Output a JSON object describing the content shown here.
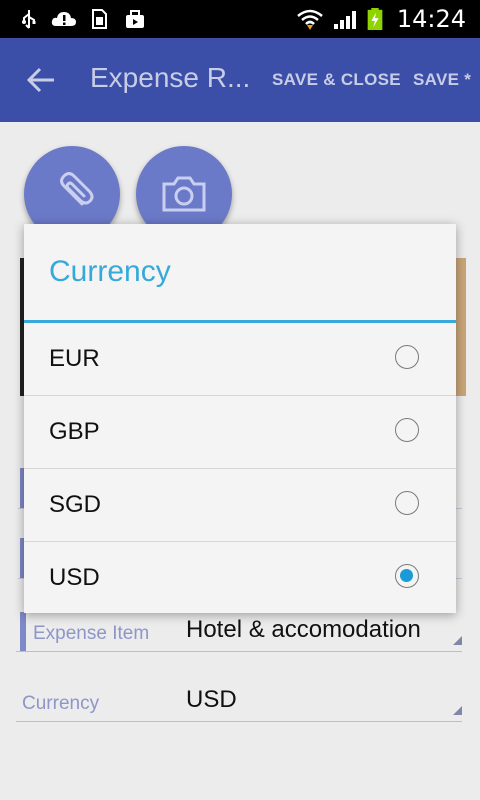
{
  "status_bar": {
    "time": "14:24",
    "icons": [
      "usb-icon",
      "cloud-alert-icon",
      "sim-icon",
      "briefcase-icon",
      "wifi-icon",
      "signal-icon",
      "battery-charging-icon"
    ]
  },
  "action_bar": {
    "title": "Expense R...",
    "save_close_label": "SAVE & CLOSE",
    "save_label": "SAVE *"
  },
  "form": {
    "attach_icon": "paperclip-icon",
    "camera_icon": "camera-icon",
    "expense_item_label": "Expense Item",
    "expense_item_value": "Hotel & accomodation",
    "currency_label": "Currency",
    "currency_value": "USD"
  },
  "dialog": {
    "title": "Currency",
    "options": [
      {
        "label": "EUR",
        "selected": false
      },
      {
        "label": "GBP",
        "selected": false
      },
      {
        "label": "SGD",
        "selected": false
      },
      {
        "label": "USD",
        "selected": true
      }
    ],
    "accent": "#35a9da"
  },
  "colors": {
    "action_bar": "#3b4fa8",
    "fab": "#6b79c9",
    "radio_selected": "#1a9bd7"
  }
}
